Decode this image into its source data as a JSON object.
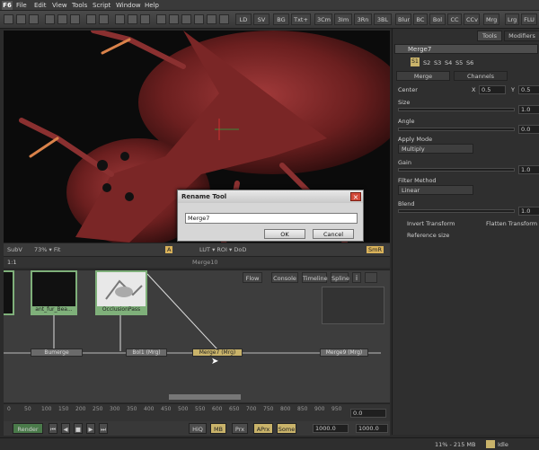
{
  "menubar": {
    "logo": "F6",
    "items": [
      "File",
      "Edit",
      "View",
      "Tools",
      "Script",
      "Window",
      "Help"
    ]
  },
  "toolbar": {
    "view_buttons": [
      "LD",
      "SV",
      "BG",
      "Txt+",
      "3Cm",
      "3Im",
      "3Rn",
      "3BL"
    ],
    "tool_buttons": [
      "Blur",
      "BC",
      "Bol",
      "CC",
      "CCv",
      "Mrg",
      "Lrg",
      "FLU"
    ]
  },
  "viewer_bar": {
    "subv": "SubV",
    "zoom": "73% ▾ Fit",
    "a": "A",
    "rest": "LUT ▾ ROI ▾ DoD",
    "smr": "SmR",
    "node_label": "Merge10",
    "frac": "1:1"
  },
  "right_panel": {
    "tabs": [
      "Tools",
      "Modifiers"
    ],
    "node_name": "Merge7",
    "channel_buttons": [
      "S1",
      "S2",
      "S3",
      "S4",
      "S5",
      "S6"
    ],
    "subtabs": [
      "Merge",
      "Channels"
    ],
    "center_label": "Center",
    "center_x_label": "X",
    "center_x": "0.5",
    "center_y_label": "Y",
    "center_y": "0.5",
    "size_label": "Size",
    "size_val": "1.0",
    "angle_label": "Angle",
    "angle_val": "0.0",
    "apply_mode_label": "Apply Mode",
    "apply_mode": "Multiply",
    "gain_label": "Gain",
    "gain_val": "1.0",
    "filter_label": "Filter Method",
    "filter_val": "Linear",
    "blend_label": "Blend",
    "blend_val": "1.0",
    "invert_label": "Invert Transform",
    "flatten_label": "Flatten Transform",
    "ref_label": "Reference size"
  },
  "dialog": {
    "title": "Rename Tool",
    "value": "Merge7",
    "ok": "OK",
    "cancel": "Cancel"
  },
  "flow": {
    "tabs": [
      "Flow",
      "Console",
      "Timeline",
      "Spline"
    ],
    "thumbs": [
      {
        "label": "ant_fur_Bea..."
      },
      {
        "label": "OcclusionPass"
      }
    ],
    "nodes": [
      {
        "label": "Bumerge",
        "selected": false
      },
      {
        "label": "Bol1 (Mrg)",
        "selected": false
      },
      {
        "label": "Merge7 (Mrg)",
        "selected": true
      },
      {
        "label": "Merge9 (Mrg)",
        "selected": false
      }
    ]
  },
  "timeline": {
    "ticks": [
      "0",
      "50",
      "100",
      "150",
      "200",
      "250",
      "300",
      "350",
      "400",
      "450",
      "500",
      "550",
      "600",
      "650",
      "700",
      "750",
      "800",
      "850",
      "900",
      "950"
    ],
    "right_val": "0.0"
  },
  "bottom_bar": {
    "render": "Render",
    "hiq": "HiQ",
    "mb": "MB",
    "prx": "Prx",
    "aprx": "APrx",
    "some": "Some",
    "frame_start": "1000.0",
    "frame_end": "1000.0"
  },
  "status": {
    "mem": "11% - 215 MB",
    "state": "Idle"
  },
  "colors": {
    "accent": "#c9b36a",
    "thumb_border": "#7fb07a",
    "close": "#d34a3a"
  }
}
